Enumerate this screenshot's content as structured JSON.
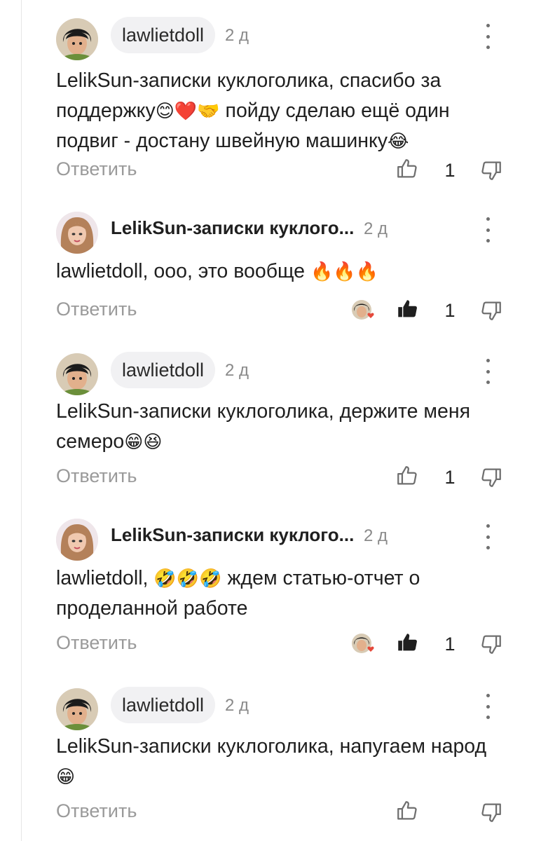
{
  "reply_label": "Ответить",
  "comments": [
    {
      "author": "lawlietdoll",
      "time": "2 д",
      "text": "LelikSun-записки куклоголика, спасибо за поддержку",
      "emoji": "😊❤️🤝",
      "text2": " пойду сделаю ещё один подвиг - достану швейную машинку",
      "emoji2": "😂",
      "likes": "1",
      "liked": false,
      "liked_by_author": false
    },
    {
      "author": "LelikSun-записки куклого...",
      "time": "2 д",
      "text": "lawlietdoll, ооо, это вообще ",
      "emoji": "🔥🔥🔥",
      "text2": "",
      "emoji2": "",
      "likes": "1",
      "liked": true,
      "liked_by_author": true
    },
    {
      "author": "lawlietdoll",
      "time": "2 д",
      "text": "LelikSun-записки куклоголика, держите меня семеро",
      "emoji": "😁😆",
      "text2": "",
      "emoji2": "",
      "likes": "1",
      "liked": false,
      "liked_by_author": false
    },
    {
      "author": "LelikSun-записки куклого...",
      "time": "2 д",
      "text": "lawlietdoll, ",
      "emoji": "🤣🤣🤣",
      "text2": " ждем статью-отчет о проделанной работе",
      "emoji2": "",
      "likes": "1",
      "liked": true,
      "liked_by_author": true
    },
    {
      "author": "lawlietdoll",
      "time": "2 д",
      "text": "LelikSun-записки куклоголика, напугаем народ ",
      "emoji": "😁",
      "text2": "",
      "emoji2": "",
      "likes": "",
      "liked": false,
      "liked_by_author": false
    }
  ],
  "colors": {
    "pill_bg": "#f1f1f3",
    "muted": "#9a9a9a",
    "time": "#8a8a8a",
    "icon": "#6f6f6f",
    "heart": "#e5493b"
  }
}
